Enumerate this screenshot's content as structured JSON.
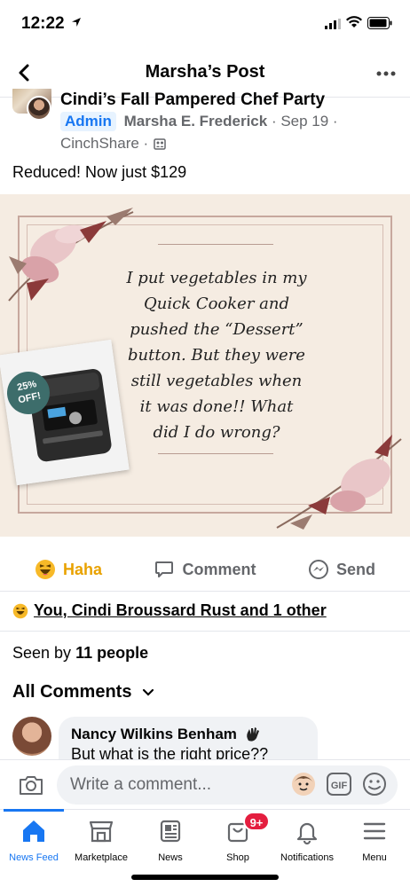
{
  "status_bar": {
    "time": "12:22"
  },
  "header": {
    "title": "Marsha’s Post"
  },
  "post": {
    "group_name": "Cindi’s Fall Pampered Chef Party",
    "admin_badge": "Admin",
    "author": "Marsha E. Frederick",
    "date": "· Sep 19 ·",
    "source": "CinchShare ·",
    "text": "Reduced! Now just $129",
    "image": {
      "quote": "I put vegetables in my Quick Cooker and pushed the “Dessert” button. But they were still vegetables when it was done!! What did I do wrong?",
      "badge_line1": "25%",
      "badge_line2": "OFF!"
    }
  },
  "actions": {
    "haha": "Haha",
    "comment": "Comment",
    "send": "Send"
  },
  "reactions": {
    "text": "You, Cindi Broussard Rust and 1 other"
  },
  "seen": {
    "prefix": "Seen by",
    "count": "11 people"
  },
  "comments": {
    "heading": "All Comments",
    "items": [
      {
        "author": "Nancy Wilkins Benham",
        "text": "But what is the right price??"
      }
    ]
  },
  "composer": {
    "placeholder": "Write a comment..."
  },
  "tabs": [
    {
      "label": "News Feed"
    },
    {
      "label": "Marketplace"
    },
    {
      "label": "News"
    },
    {
      "label": "Shop",
      "badge": "9+"
    },
    {
      "label": "Notifications"
    },
    {
      "label": "Menu"
    }
  ],
  "colors": {
    "accent": "#1877f2",
    "badge": "#e41e3f",
    "haha": "#e9a200"
  }
}
